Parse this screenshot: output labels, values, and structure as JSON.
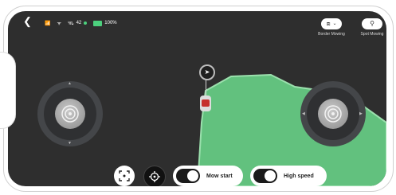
{
  "status_bar": {
    "back_icon": "chevron-left-icon",
    "signal_icon": "signal-icon",
    "wifi_icon": "wifi-icon",
    "satellite_count": "42",
    "battery_percent": "100%",
    "battery_level": 1.0,
    "accent_color": "#4cd07d"
  },
  "modes": [
    {
      "label": "Border Mowing",
      "icon": "border-mowing-icon"
    },
    {
      "label": "Spot Mowing",
      "icon": "spot-mowing-icon"
    }
  ],
  "controls": {
    "mow_start_label": "Mow start",
    "high_speed_label": "High speed",
    "mow_start_on": true,
    "high_speed_on": true
  },
  "map": {
    "lawn_color": "#62c17e",
    "lawn_edge_color": "#9be0ad"
  }
}
